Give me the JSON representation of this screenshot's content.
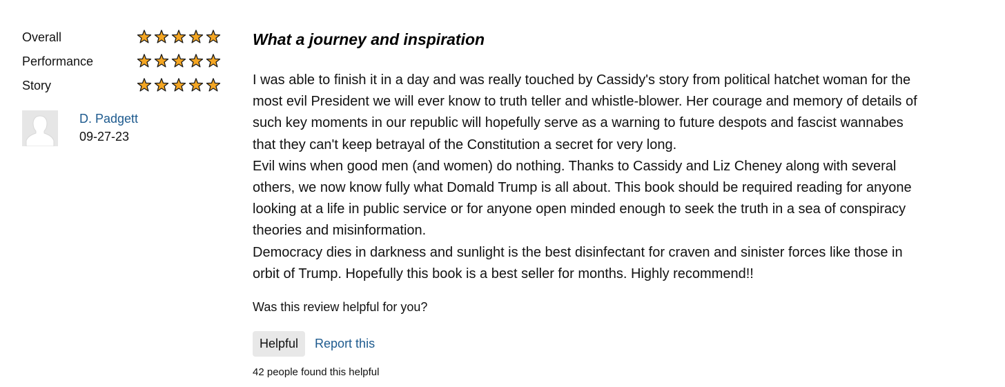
{
  "ratings": [
    {
      "label": "Overall",
      "stars": 5
    },
    {
      "label": "Performance",
      "stars": 5
    },
    {
      "label": "Story",
      "stars": 5
    }
  ],
  "reviewer": {
    "name": "D. Padgett",
    "date": "09-27-23",
    "avatar_icon": "user-silhouette-icon"
  },
  "review": {
    "title": "What a journey and inspiration",
    "paragraphs": [
      "I was able to finish it in a day and was really touched by Cassidy's story from political hatchet woman for the most evil President we will ever know to truth teller and whistle-blower. Her courage and memory of details of such key moments in our republic will hopefully serve as a warning to future despots and fascist wannabes that they can't keep betrayal of the Constitution a secret for very long.",
      "Evil wins when good men (and women) do nothing. Thanks to Cassidy and Liz Cheney along with several others, we now know fully what Domald Trump is all about. This book should be required reading for anyone looking at a life in public service or for anyone open minded enough to seek the truth in a sea of conspiracy theories and misinformation.",
      "Democracy dies in darkness and sunlight is the best disinfectant for craven and sinister forces like those in orbit of Trump. Hopefully this book is a best seller for months. Highly recommend!!"
    ]
  },
  "feedback": {
    "question": "Was this review helpful for you?",
    "helpful_label": "Helpful",
    "report_label": "Report this",
    "count_text": "42 people found this helpful"
  },
  "colors": {
    "star_fill": "#f4a623",
    "star_outline": "#1a1a1a",
    "link": "#1d5a8e",
    "button_bg": "#e8e8e8",
    "avatar_bg": "#e6e6e6"
  }
}
